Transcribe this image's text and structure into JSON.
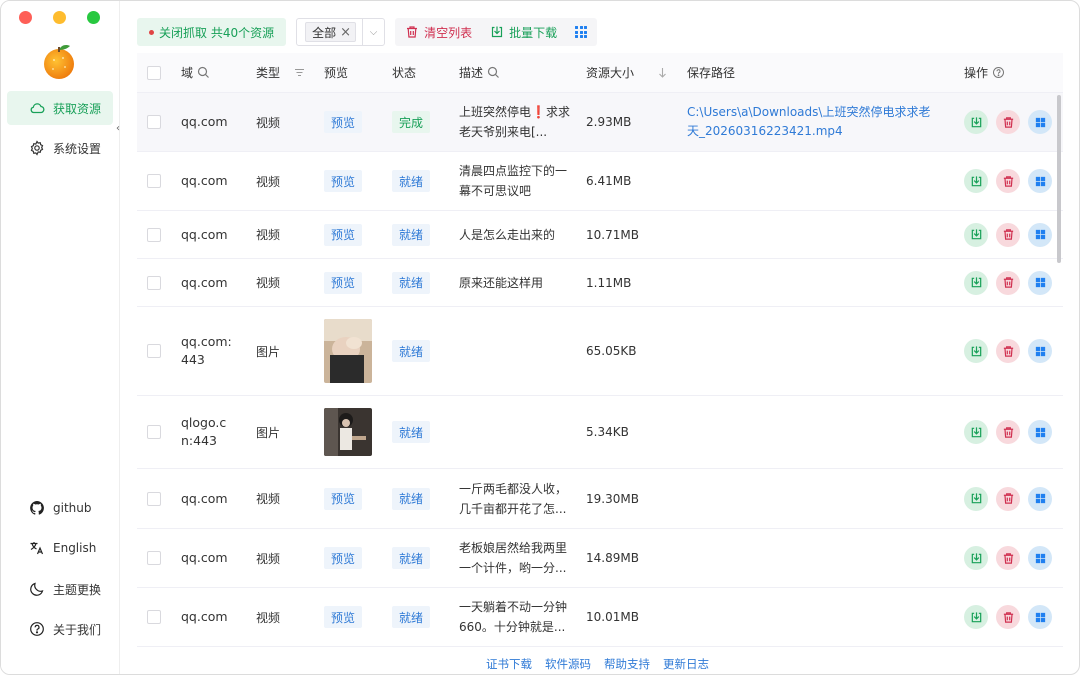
{
  "sidebar": {
    "nav": [
      {
        "label": "获取资源",
        "icon": "cloud-icon",
        "active": true
      },
      {
        "label": "系统设置",
        "icon": "gear-icon",
        "active": false
      }
    ],
    "bottom": [
      {
        "label": "github",
        "icon": "github-icon"
      },
      {
        "label": "English",
        "icon": "translate-icon"
      },
      {
        "label": "主题更换",
        "icon": "moon-icon"
      },
      {
        "label": "关于我们",
        "icon": "help-circle-icon"
      }
    ]
  },
  "toolbar": {
    "capture_label": "关闭抓取 共40个资源",
    "filter_tag": "全部",
    "clear_label": "清空列表",
    "batch_label": "批量下载"
  },
  "table": {
    "headers": {
      "domain": "域",
      "type": "类型",
      "preview": "预览",
      "status": "状态",
      "desc": "描述",
      "size": "资源大小",
      "path": "保存路径",
      "ops": "操作"
    },
    "rows": [
      {
        "domain": "qq.com",
        "type": "视频",
        "preview": "预览",
        "status": "完成",
        "desc": "上班突然停电❗求求老天爷别来电[...",
        "size": "2.93MB",
        "path": "C:\\Users\\a\\Downloads\\上班突然停电求求老天_20260316223421.mp4"
      },
      {
        "domain": "qq.com",
        "type": "视频",
        "preview": "预览",
        "status": "就绪",
        "desc": "清晨四点监控下的一幕不可思议吧",
        "size": "6.41MB",
        "path": ""
      },
      {
        "domain": "qq.com",
        "type": "视频",
        "preview": "预览",
        "status": "就绪",
        "desc": "人是怎么走出来的",
        "size": "10.71MB",
        "path": ""
      },
      {
        "domain": "qq.com",
        "type": "视频",
        "preview": "预览",
        "status": "就绪",
        "desc": "原来还能这样用",
        "size": "1.11MB",
        "path": ""
      },
      {
        "domain": "qq.com:443",
        "type": "图片",
        "preview": "",
        "status": "就绪",
        "desc": "",
        "size": "65.05KB",
        "path": ""
      },
      {
        "domain": "qlogo.cn:443",
        "type": "图片",
        "preview": "",
        "status": "就绪",
        "desc": "",
        "size": "5.34KB",
        "path": ""
      },
      {
        "domain": "qq.com",
        "type": "视频",
        "preview": "预览",
        "status": "就绪",
        "desc": "一斤两毛都没人收，几千亩都开花了怎...",
        "size": "19.30MB",
        "path": ""
      },
      {
        "domain": "qq.com",
        "type": "视频",
        "preview": "预览",
        "status": "就绪",
        "desc": "老板娘居然给我两里一个计件，哟一分...",
        "size": "14.89MB",
        "path": ""
      },
      {
        "domain": "qq.com",
        "type": "视频",
        "preview": "预览",
        "status": "就绪",
        "desc": "一天躺着不动一分钟660。十分钟就是...",
        "size": "10.01MB",
        "path": ""
      }
    ]
  },
  "footer": {
    "links": [
      "证书下载",
      "软件源码",
      "帮助支持",
      "更新日志"
    ]
  },
  "colors": {
    "accent_green": "#18a058",
    "link_blue": "#2f7ad6",
    "danger_red": "#d03050"
  }
}
